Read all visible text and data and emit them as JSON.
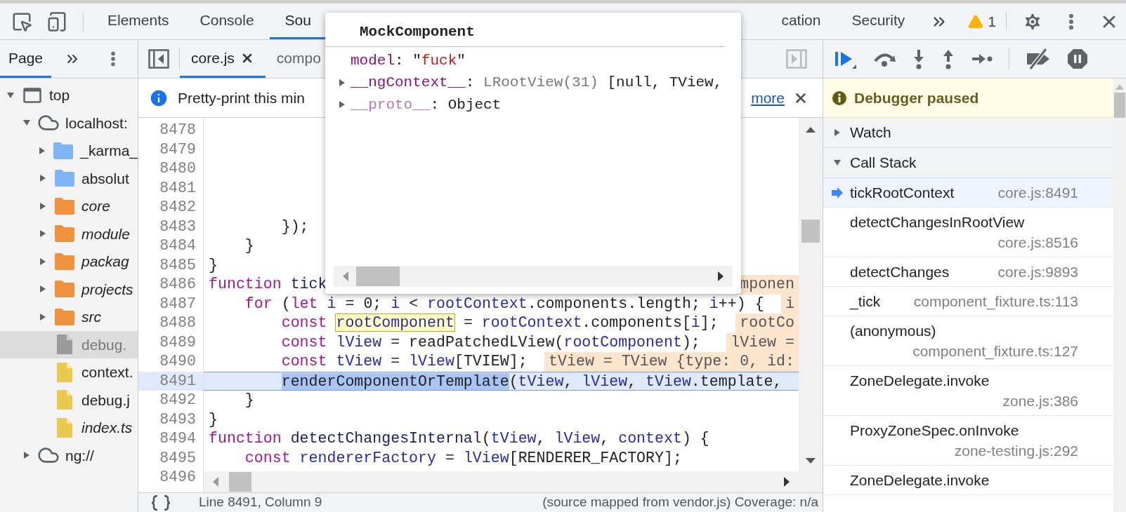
{
  "main_tabs": [
    {
      "label": "Elements",
      "selected": false
    },
    {
      "label": "Console",
      "selected": false
    },
    {
      "label": "Sou",
      "selected": true
    }
  ],
  "tabs_right_of_popover": [
    {
      "label": "cation",
      "selected": false
    },
    {
      "label": "Security",
      "selected": false
    }
  ],
  "warnings": {
    "count": "1"
  },
  "navigator": {
    "tabs": [
      {
        "label": "Page",
        "selected": true
      }
    ],
    "tree": [
      {
        "label": "top",
        "kind": "frame",
        "expanded": true,
        "selected": false,
        "italic": false,
        "children": [
          {
            "label": "localhost:",
            "kind": "origin",
            "expanded": true,
            "selected": false,
            "italic": false,
            "children": [
              {
                "label": "_karma_",
                "kind": "folder",
                "color": "#7fb5f5",
                "expanded": false,
                "selected": false,
                "italic": false
              },
              {
                "label": "absolut",
                "kind": "folder",
                "color": "#7fb5f5",
                "expanded": false,
                "selected": false,
                "italic": false
              },
              {
                "label": "core",
                "kind": "folder",
                "color": "#f0913d",
                "expanded": false,
                "selected": false,
                "italic": true
              },
              {
                "label": "module",
                "kind": "folder",
                "color": "#f0913d",
                "expanded": false,
                "selected": false,
                "italic": true
              },
              {
                "label": "packag",
                "kind": "folder",
                "color": "#f0913d",
                "expanded": false,
                "selected": false,
                "italic": true
              },
              {
                "label": "projects",
                "kind": "folder",
                "color": "#f0913d",
                "expanded": false,
                "selected": false,
                "italic": true
              },
              {
                "label": "src",
                "kind": "folder",
                "color": "#f0913d",
                "expanded": false,
                "selected": false,
                "italic": true
              },
              {
                "label": "debug.",
                "kind": "file",
                "color": "#9b9b9b",
                "selected": true,
                "italic": false
              },
              {
                "label": "context.",
                "kind": "file",
                "color": "#ebc94e",
                "selected": false,
                "italic": false
              },
              {
                "label": "debug.j",
                "kind": "file",
                "color": "#ebc94e",
                "selected": false,
                "italic": false
              },
              {
                "label": "index.ts",
                "kind": "file",
                "color": "#ebc94e",
                "selected": false,
                "italic": true
              }
            ]
          },
          {
            "label": "ng://",
            "kind": "origin",
            "expanded": false,
            "selected": false,
            "italic": false
          }
        ]
      }
    ]
  },
  "editor": {
    "tabs": [
      {
        "label": "core.js",
        "selected": true
      },
      {
        "label": "compo",
        "selected": false
      }
    ],
    "info_bar": {
      "message": "Pretty-print this min",
      "link": "more"
    },
    "lines": [
      {
        "number": "8478",
        "current": false
      },
      {
        "number": "8479",
        "current": false
      },
      {
        "number": "8480",
        "current": false
      },
      {
        "number": "8481",
        "current": false
      },
      {
        "number": "8482",
        "current": false
      },
      {
        "number": "8483",
        "current": false,
        "tokens": [
          {
            "kind": "plain",
            "t": "        });"
          }
        ]
      },
      {
        "number": "8484",
        "current": false,
        "tokens": [
          {
            "kind": "plain",
            "t": "    }"
          }
        ]
      },
      {
        "number": "8485",
        "current": false,
        "tokens": [
          {
            "kind": "plain",
            "t": "}"
          }
        ]
      },
      {
        "number": "8486",
        "current": false,
        "tokens": [
          {
            "kind": "kw",
            "t": "function"
          },
          {
            "kind": "fn",
            "t": " tick"
          }
        ],
        "inline_value": "mponen"
      },
      {
        "number": "8487",
        "current": false,
        "tokens": [
          {
            "kind": "kw",
            "t": "    for"
          },
          {
            "kind": "plain",
            "t": " ("
          },
          {
            "kind": "kw",
            "t": "let"
          },
          {
            "kind": "var",
            "t": " i"
          },
          {
            "kind": "plain",
            "t": " = 0; "
          },
          {
            "kind": "var",
            "t": "i"
          },
          {
            "kind": "plain",
            "t": " < "
          },
          {
            "kind": "var",
            "t": "rootContext"
          },
          {
            "kind": "plain",
            "t": ".components.length; "
          },
          {
            "kind": "var",
            "t": "i"
          },
          {
            "kind": "plain",
            "t": "++) {"
          }
        ],
        "inline_value": "i"
      },
      {
        "number": "8488",
        "current": false,
        "tokens": [
          {
            "kind": "kw",
            "t": "        const "
          },
          {
            "kind": "hover",
            "t": "rootComponent"
          },
          {
            "kind": "plain",
            "t": " = "
          },
          {
            "kind": "var",
            "t": "rootContext"
          },
          {
            "kind": "plain",
            "t": ".components["
          },
          {
            "kind": "var",
            "t": "i"
          },
          {
            "kind": "plain",
            "t": "];"
          }
        ],
        "inline_value": "rootCo"
      },
      {
        "number": "8489",
        "current": false,
        "tokens": [
          {
            "kind": "kw",
            "t": "        const "
          },
          {
            "kind": "var",
            "t": "lView"
          },
          {
            "kind": "plain",
            "t": " = readPatchedLView("
          },
          {
            "kind": "var",
            "t": "rootComponent"
          },
          {
            "kind": "plain",
            "t": ");"
          }
        ],
        "inline_value": "lView ="
      },
      {
        "number": "8490",
        "current": false,
        "tokens": [
          {
            "kind": "kw",
            "t": "        const "
          },
          {
            "kind": "var",
            "t": "tView"
          },
          {
            "kind": "plain",
            "t": " = "
          },
          {
            "kind": "var",
            "t": "lView"
          },
          {
            "kind": "plain",
            "t": "[TVIEW];"
          }
        ],
        "inline_value": "tView = TView {type: 0, id:"
      },
      {
        "number": "8491",
        "current": true,
        "tokens": [
          {
            "kind": "sel",
            "t": "        renderComponentOrTemplate"
          },
          {
            "kind": "plain",
            "t": "("
          },
          {
            "kind": "var",
            "t": "tView"
          },
          {
            "kind": "plain",
            "t": ", "
          },
          {
            "kind": "var",
            "t": "lView"
          },
          {
            "kind": "plain",
            "t": ", "
          },
          {
            "kind": "var",
            "t": "tView"
          },
          {
            "kind": "plain",
            "t": ".template,"
          }
        ]
      },
      {
        "number": "8492",
        "current": false,
        "tokens": [
          {
            "kind": "plain",
            "t": "    }"
          }
        ]
      },
      {
        "number": "8493",
        "current": false,
        "tokens": [
          {
            "kind": "plain",
            "t": "}"
          }
        ]
      },
      {
        "number": "8494",
        "current": false,
        "tokens": [
          {
            "kind": "kw",
            "t": "function"
          },
          {
            "kind": "fn",
            "t": " detectChangesInternal"
          },
          {
            "kind": "plain",
            "t": "("
          },
          {
            "kind": "var",
            "t": "tView"
          },
          {
            "kind": "plain",
            "t": ", "
          },
          {
            "kind": "var",
            "t": "lView"
          },
          {
            "kind": "plain",
            "t": ", "
          },
          {
            "kind": "var",
            "t": "context"
          },
          {
            "kind": "plain",
            "t": ") {"
          }
        ]
      },
      {
        "number": "8495",
        "current": false,
        "tokens": [
          {
            "kind": "kw",
            "t": "    const"
          },
          {
            "kind": "var",
            "t": " rendererFactory"
          },
          {
            "kind": "plain",
            "t": " = "
          },
          {
            "kind": "var",
            "t": "lView"
          },
          {
            "kind": "plain",
            "t": "[RENDERER_FACTORY];"
          }
        ]
      },
      {
        "number": "8496",
        "current": false
      }
    ]
  },
  "popover": {
    "title": "MockComponent",
    "properties": [
      {
        "name": "model",
        "kind": "primitive",
        "enumerable": true,
        "value": [
          {
            "kind": "plain",
            "t": ": \""
          },
          {
            "kind": "string",
            "t": "fuck"
          },
          {
            "kind": "plain",
            "t": "\""
          }
        ]
      },
      {
        "name": "__ngContext__",
        "kind": "object",
        "expanded": false,
        "enumerable": true,
        "value": [
          {
            "kind": "plain",
            "t": ": "
          },
          {
            "kind": "class",
            "t": "LRootView(31)"
          },
          {
            "kind": "plain",
            "t": " [null, TView,"
          }
        ]
      },
      {
        "name": "__proto__",
        "kind": "object",
        "expanded": false,
        "enumerable": false,
        "value": [
          {
            "kind": "plain",
            "t": ": Object"
          }
        ]
      }
    ]
  },
  "debugger": {
    "status": "Debugger paused",
    "sections": [
      {
        "title": "Watch",
        "expanded": false
      },
      {
        "title": "Call Stack",
        "expanded": true
      }
    ],
    "call_stack": [
      {
        "function": "tickRootContext",
        "location": "core.js:8491",
        "selected": true
      },
      {
        "function": "detectChangesInRootView",
        "location": "core.js:8516",
        "selected": false
      },
      {
        "function": "detectChanges",
        "location": "core.js:9893",
        "selected": false
      },
      {
        "function": "_tick",
        "location": "component_fixture.ts:113",
        "selected": false
      },
      {
        "function": "(anonymous)",
        "location": "component_fixture.ts:127",
        "selected": false
      },
      {
        "function": "ZoneDelegate.invoke",
        "location": "zone.js:386",
        "selected": false
      },
      {
        "function": "ProxyZoneSpec.onInvoke",
        "location": "zone-testing.js:292",
        "selected": false
      },
      {
        "function": "ZoneDelegate.invoke",
        "selected": false
      }
    ]
  },
  "status_bar": {
    "position": "Line 8491, Column 9",
    "source": "(source mapped from vendor.js) Coverage: n/a"
  }
}
